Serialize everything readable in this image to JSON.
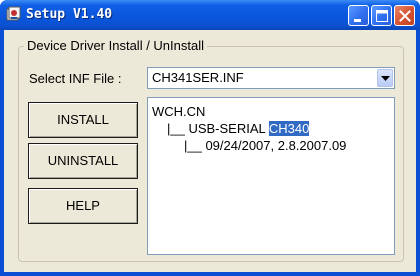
{
  "window": {
    "title": "Setup V1.40"
  },
  "group": {
    "title": "Device Driver Install / UnInstall"
  },
  "inf": {
    "label": "Select INF File :",
    "selected": "CH341SER.INF"
  },
  "buttons": {
    "install": "INSTALL",
    "uninstall": "UNINSTALL",
    "help": "HELP"
  },
  "tree": {
    "line0": "WCH.CN",
    "line1_prefix": "|__ USB-SERIAL ",
    "line1_highlight": "CH340",
    "line2": "|__ 09/24/2007, 2.8.2007.09"
  },
  "colors": {
    "titlebar": "#0A56DD",
    "face": "#ECE9D8",
    "selection": "#316AC5"
  },
  "icons": {
    "app": "setup-app-icon",
    "minimize": "minimize-icon",
    "maximize": "maximize-icon",
    "close": "close-icon",
    "dropdown": "chevron-down-icon"
  }
}
